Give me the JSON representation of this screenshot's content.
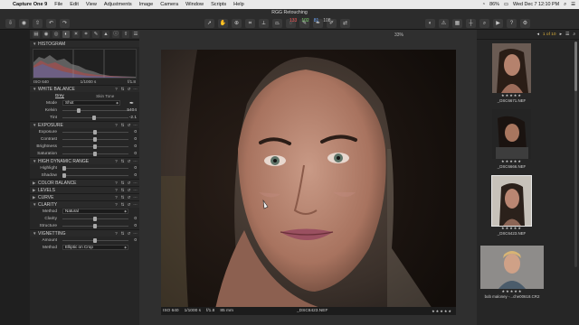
{
  "menubar": {
    "apple_icon": "apple-logo-icon",
    "items": [
      "Capture One 9",
      "File",
      "Edit",
      "View",
      "Adjustments",
      "Image",
      "Camera",
      "Window",
      "Scripts",
      "Help"
    ],
    "battery": "86%",
    "clock": "Wed Dec 7  12:10 PM"
  },
  "window": {
    "title": "RGG Retouching"
  },
  "toolbar": {
    "color_readout": [
      "133",
      "102",
      "81",
      "108"
    ],
    "color_readout_colors": [
      "#ff5a5a",
      "#7cd66f",
      "#6aa6ff",
      "#bdbdbd"
    ],
    "zoom": "33%",
    "page_counter": "1 of 10"
  },
  "left_panel": {
    "histogram": {
      "title": "HISTOGRAM",
      "iso": "ISO 640",
      "shutter": "1/1000 s",
      "aperture": "f/1.8"
    },
    "white_balance": {
      "title": "WHITE BALANCE",
      "tabs": [
        "Grey",
        "Skin Tone"
      ],
      "mode_label": "Mode",
      "mode_value": "Shot",
      "kelvin_label": "Kelvin",
      "kelvin_value": "5404",
      "tint_label": "Tint",
      "tint_value": "-2.1"
    },
    "exposure": {
      "title": "EXPOSURE",
      "rows": [
        {
          "label": "Exposure",
          "value": "0"
        },
        {
          "label": "Contrast",
          "value": "0"
        },
        {
          "label": "Brightness",
          "value": "0"
        },
        {
          "label": "Saturation",
          "value": "0"
        }
      ]
    },
    "hdr": {
      "title": "HIGH DYNAMIC RANGE",
      "rows": [
        {
          "label": "Highlight",
          "value": "0"
        },
        {
          "label": "Shadow",
          "value": "0"
        }
      ]
    },
    "collapsed": [
      "COLOR BALANCE",
      "LEVELS",
      "CURVE"
    ],
    "clarity": {
      "title": "CLARITY",
      "method_label": "Method",
      "method_value": "Natural",
      "rows": [
        {
          "label": "Clarity",
          "value": "0"
        },
        {
          "label": "Structure",
          "value": "0"
        }
      ]
    },
    "vignetting": {
      "title": "VIGNETTING",
      "amount_label": "Amount",
      "amount_value": "0",
      "method_label": "Method",
      "method_value": "Elliptic on Crop"
    }
  },
  "viewer": {
    "status": {
      "iso": "ISO 640",
      "shutter": "1/1000 s",
      "aperture": "f/1.8",
      "focal": "85 mm",
      "filename": "_DSC6423.NEF"
    }
  },
  "browser": {
    "thumbs": [
      {
        "name": "_DSC6671.NEF"
      },
      {
        "name": "_DSC6666.NEF"
      },
      {
        "name": "_DSC6423.NEF"
      },
      {
        "name": "bob maloney -...che00618.CR2"
      }
    ]
  }
}
